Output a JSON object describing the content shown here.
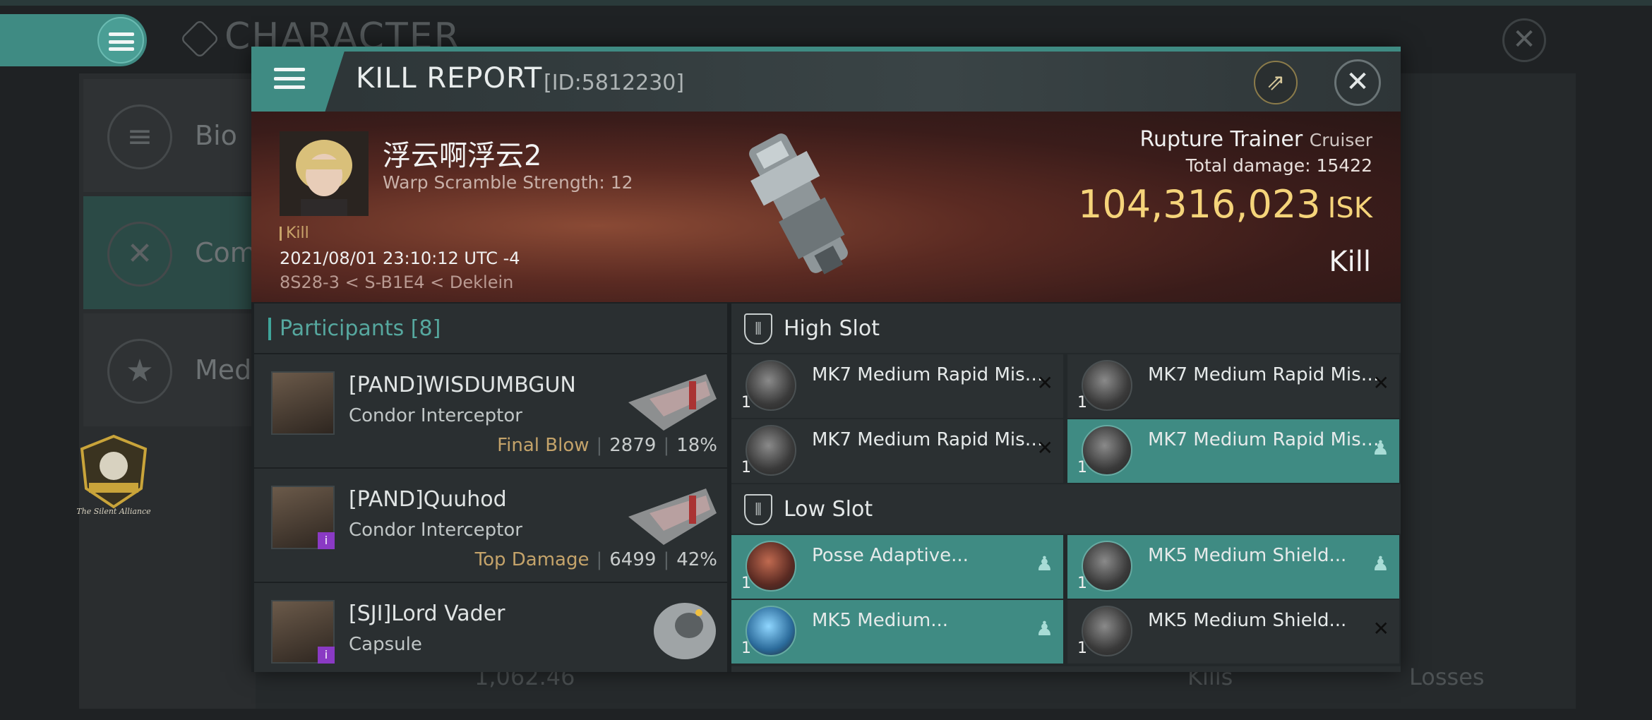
{
  "background": {
    "title": "CHARACTER",
    "tabs": [
      {
        "label": "Bio",
        "icon": "list-icon"
      },
      {
        "label": "Com",
        "icon": "swords-icon"
      },
      {
        "label": "Meda",
        "icon": "star-icon"
      }
    ],
    "alliance_name": "The Silent Alliance",
    "bottom_value": "1,062.46",
    "bottom_kills": "Kills",
    "bottom_losses": "Losses"
  },
  "modal": {
    "title": "KILL REPORT",
    "id": "[ID:5812230]",
    "victim": {
      "name": "浮云啊浮云2",
      "warp_scramble": "Warp Scramble Strength: 12",
      "tag": "Kill",
      "datetime": "2021/08/01 23:10:12 UTC -4",
      "location": "8S28-3 < S-B1E4 < Deklein"
    },
    "ship": {
      "name": "Rupture Trainer",
      "class": "Cruiser",
      "total_damage_label": "Total damage:",
      "total_damage": "15422",
      "isk_value": "104,316,023",
      "isk_unit": "ISK",
      "result": "Kill"
    },
    "participants": {
      "label": "Participants",
      "count": "[8]",
      "items": [
        {
          "name": "[PAND]WISDUMBGUN",
          "ship": "Condor Interceptor",
          "tag": "Final Blow",
          "damage": "2879",
          "percent": "18%"
        },
        {
          "name": "[PAND]Quuhod",
          "ship": "Condor Interceptor",
          "tag": "Top Damage",
          "damage": "6499",
          "percent": "42%"
        },
        {
          "name": "[SJI]Lord Vader",
          "ship": "Capsule",
          "tag": "",
          "damage": "",
          "percent": ""
        }
      ]
    },
    "high_slot": {
      "label": "High Slot",
      "items": [
        {
          "name": "MK7 Medium Rapid Missile...",
          "qty": "1",
          "status": "destroyed"
        },
        {
          "name": "MK7 Medium Rapid Missile...",
          "qty": "1",
          "status": "destroyed"
        },
        {
          "name": "MK7 Medium Rapid Missile...",
          "qty": "1",
          "status": "destroyed"
        },
        {
          "name": "MK7 Medium Rapid Missile...",
          "qty": "1",
          "status": "dropped"
        }
      ]
    },
    "low_slot": {
      "label": "Low Slot",
      "items": [
        {
          "name": "Posse Adaptive...",
          "qty": "1",
          "status": "dropped"
        },
        {
          "name": "MK5 Medium Shield...",
          "qty": "1",
          "status": "dropped"
        },
        {
          "name": "MK5 Medium...",
          "qty": "1",
          "status": "dropped"
        },
        {
          "name": "MK5 Medium Shield...",
          "qty": "1",
          "status": "destroyed"
        }
      ]
    }
  },
  "colors": {
    "accent": "#3f8b83",
    "isk": "#f5d47a",
    "tag": "#c4a36a"
  }
}
